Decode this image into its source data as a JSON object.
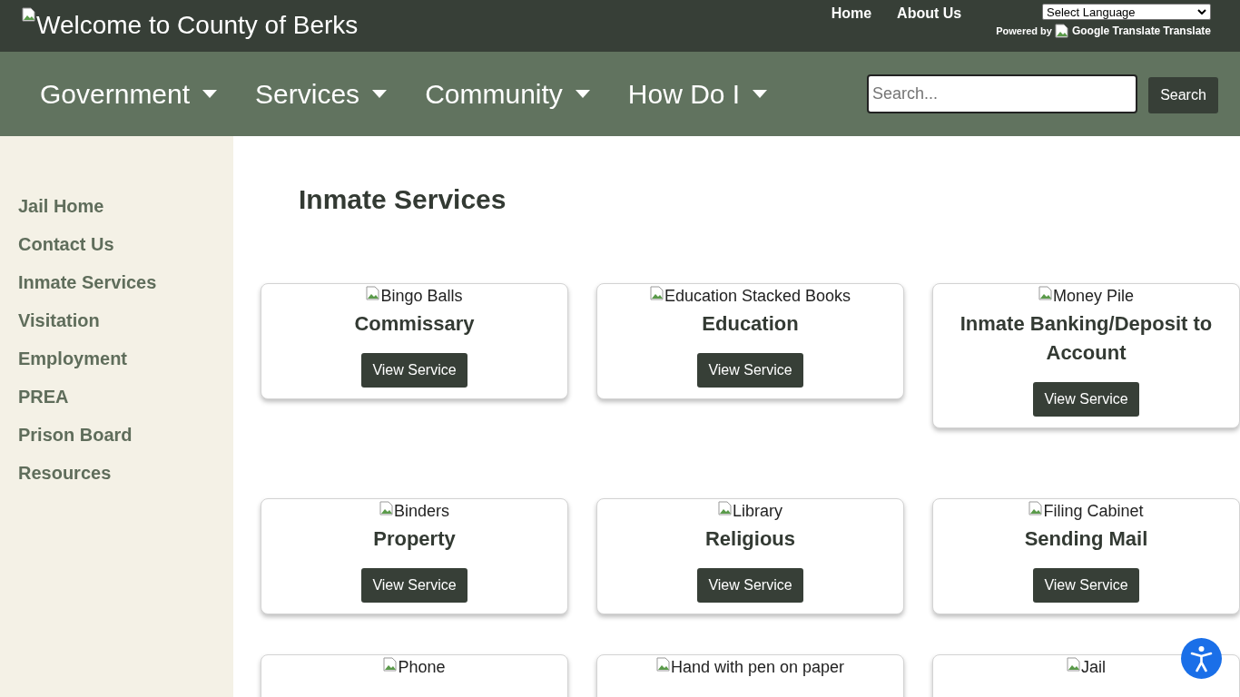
{
  "header": {
    "logo_alt": "Welcome to County of Berks",
    "links": [
      "Home",
      "About Us"
    ],
    "language_select": "Select Language",
    "powered_by": "Powered by",
    "translate_alt": "Google Translate",
    "translate_label": "Translate"
  },
  "nav": {
    "items": [
      "Government",
      "Services",
      "Community",
      "How Do I"
    ],
    "search": {
      "placeholder": "Search..."
    },
    "search_button": "Search"
  },
  "sidebar": {
    "items": [
      {
        "label": "Jail Home",
        "selected": false
      },
      {
        "label": "Contact Us",
        "selected": false
      },
      {
        "label": "Inmate Services",
        "selected": false
      },
      {
        "label": "Visitation",
        "selected": false
      },
      {
        "label": "Employment",
        "selected": false
      },
      {
        "label": "PREA",
        "selected": false
      },
      {
        "label": "Prison Board",
        "selected": false
      },
      {
        "label": "Resources",
        "selected": false
      }
    ]
  },
  "page_title": "Inmate Services",
  "card_rows": [
    [
      {
        "image_alt": "Bingo Balls",
        "title": "Commissary",
        "button": "View Service"
      },
      {
        "image_alt": "Education Stacked Books",
        "title": "Education",
        "button": "View Service"
      },
      {
        "image_alt": "Money Pile",
        "title": "Inmate Banking/Deposit to Account",
        "button": "View Service"
      }
    ],
    [
      {
        "image_alt": "Binders",
        "title": "Property",
        "button": "View Service"
      },
      {
        "image_alt": "Library",
        "title": "Religious",
        "button": "View Service"
      },
      {
        "image_alt": "Filing Cabinet",
        "title": "Sending Mail",
        "button": "View Service"
      }
    ],
    [
      {
        "image_alt": "Phone"
      },
      {
        "image_alt": "Hand with pen on paper"
      },
      {
        "image_alt": "Jail"
      }
    ]
  ]
}
